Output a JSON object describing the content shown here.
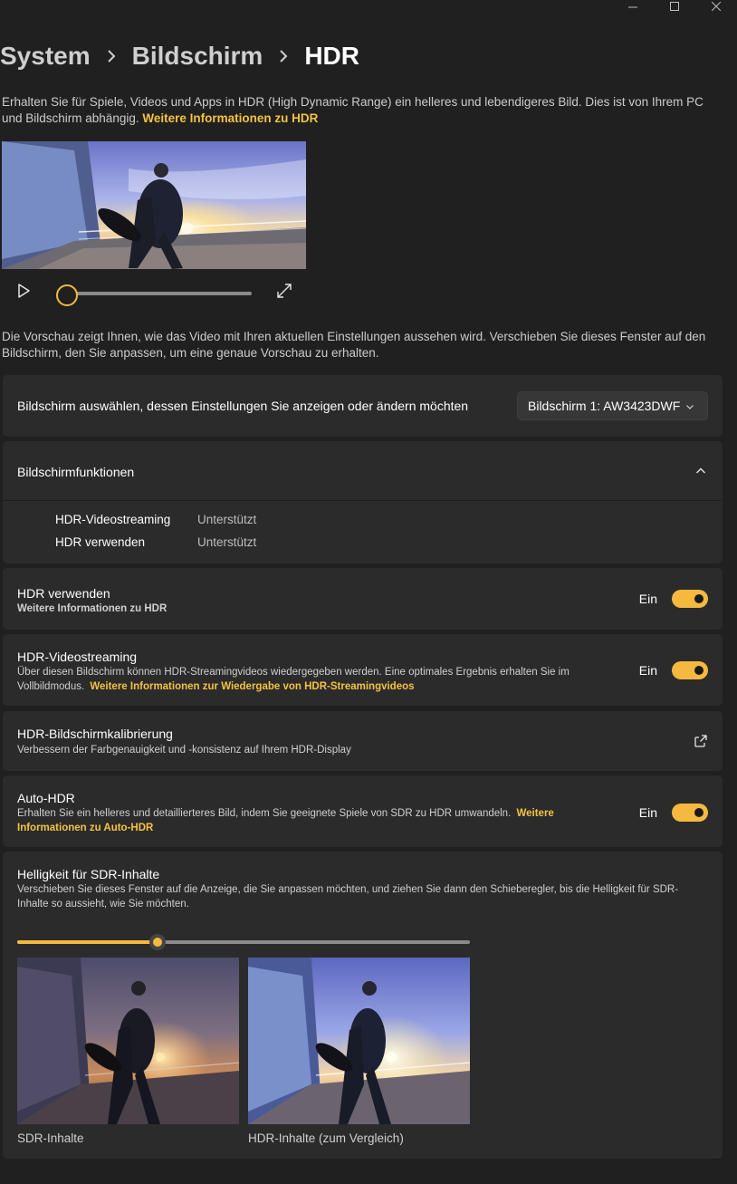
{
  "window": {
    "minimize_icon": "minimize-icon",
    "maximize_icon": "maximize-icon",
    "close_icon": "close-icon"
  },
  "breadcrumb": {
    "items": [
      "System",
      "Bildschirm"
    ],
    "current": "HDR"
  },
  "intro": {
    "text": "Erhalten Sie für Spiele, Videos und Apps in HDR (High Dynamic Range) ein helleres und lebendigeres Bild. Dies ist von Ihrem PC und Bildschirm abhängig.",
    "link": "Weitere Informationen zu HDR"
  },
  "video": {
    "progress": 0
  },
  "preview_note": "Die Vorschau zeigt Ihnen, wie das Video mit Ihren aktuellen Einstellungen aussehen wird. Verschieben Sie dieses Fenster auf den Bildschirm, den Sie anpassen, um eine genaue Vorschau zu erhalten.",
  "display_select": {
    "label": "Bildschirm auswählen, dessen Einstellungen Sie anzeigen oder ändern möchten",
    "value": "Bildschirm 1: AW3423DWF"
  },
  "capabilities": {
    "title": "Bildschirmfunktionen",
    "rows": [
      {
        "name": "HDR-Videostreaming",
        "value": "Unterstützt"
      },
      {
        "name": "HDR verwenden",
        "value": "Unterstützt"
      }
    ]
  },
  "use_hdr": {
    "title": "HDR verwenden",
    "link": "Weitere Informationen zu HDR",
    "state": "Ein",
    "on": true
  },
  "hdr_streaming": {
    "title": "HDR-Videostreaming",
    "desc": "Über diesen Bildschirm können HDR-Streamingvideos wiedergegeben werden. Eine optimales Ergebnis erhalten Sie im Vollbildmodus.",
    "link": "Weitere Informationen zur Wiedergabe von HDR-Streamingvideos",
    "state": "Ein",
    "on": true
  },
  "calibration": {
    "title": "HDR-Bildschirmkalibrierung",
    "desc": "Verbessern der Farbgenauigkeit und -konsistenz auf Ihrem HDR-Display"
  },
  "auto_hdr": {
    "title": "Auto-HDR",
    "desc": "Erhalten Sie ein helleres und detaillierteres Bild, indem Sie geeignete Spiele von SDR zu HDR umwandeln.",
    "link": "Weitere Informationen zu Auto-HDR",
    "state": "Ein",
    "on": true
  },
  "sdr_brightness": {
    "title": "Helligkeit für SDR-Inhalte",
    "desc": "Verschieben Sie dieses Fenster auf die Anzeige, die Sie anpassen möchten, und ziehen Sie dann den Schieberegler, bis die Helligkeit für SDR-Inhalte so aussieht, wie Sie möchten.",
    "value_fraction": 0.31,
    "sdr_caption": "SDR-Inhalte",
    "hdr_caption": "HDR-Inhalte (zum Vergleich)"
  },
  "colors": {
    "accent": "#f5b93f",
    "link": "#f5c242",
    "background": "#202020",
    "card": "#2b2b2b"
  }
}
